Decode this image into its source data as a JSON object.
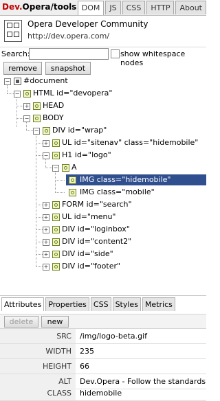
{
  "app": {
    "brand": "Dev.",
    "title_rest": "Opera/tools"
  },
  "top_tabs": [
    "DOM",
    "JS",
    "CSS",
    "HTTP",
    "About"
  ],
  "header": {
    "title": "Opera Developer Community",
    "url": "http://dev.opera.com/"
  },
  "search": {
    "label": "Search:",
    "value": "",
    "whitespace_label": "show whitespace nodes"
  },
  "actions": {
    "remove": "remove",
    "snapshot": "snapshot"
  },
  "tree": [
    {
      "label": "#document"
    },
    {
      "label": "HTML id=\"devopera\""
    },
    {
      "label": "HEAD"
    },
    {
      "label": "BODY"
    },
    {
      "label": "DIV id=\"wrap\""
    },
    {
      "label": "UL id=\"sitenav\" class=\"hidemobile\""
    },
    {
      "label": "H1 id=\"logo\""
    },
    {
      "label": "A"
    },
    {
      "label": "IMG class=\"hidemobile\""
    },
    {
      "label": "IMG class=\"mobile\""
    },
    {
      "label": "FORM id=\"search\""
    },
    {
      "label": "UL id=\"menu\""
    },
    {
      "label": "DIV id=\"loginbox\""
    },
    {
      "label": "DIV id=\"content2\""
    },
    {
      "label": "DIV id=\"side\""
    },
    {
      "label": "DIV id=\"footer\""
    }
  ],
  "bottom_tabs": [
    "Attributes",
    "Properties",
    "CSS",
    "Styles",
    "Metrics"
  ],
  "attr_actions": {
    "delete": "delete",
    "new": "new"
  },
  "attributes": [
    {
      "name": "SRC",
      "value": "/img/logo-beta.gif"
    },
    {
      "name": "WIDTH",
      "value": "235"
    },
    {
      "name": "HEIGHT",
      "value": "66"
    },
    {
      "name": "ALT",
      "value": "Dev.Opera - Follow the standards, br"
    },
    {
      "name": "CLASS",
      "value": "hidemobile"
    }
  ],
  "colors": {
    "selection": "#2f4f8f",
    "brand": "#c00000"
  }
}
